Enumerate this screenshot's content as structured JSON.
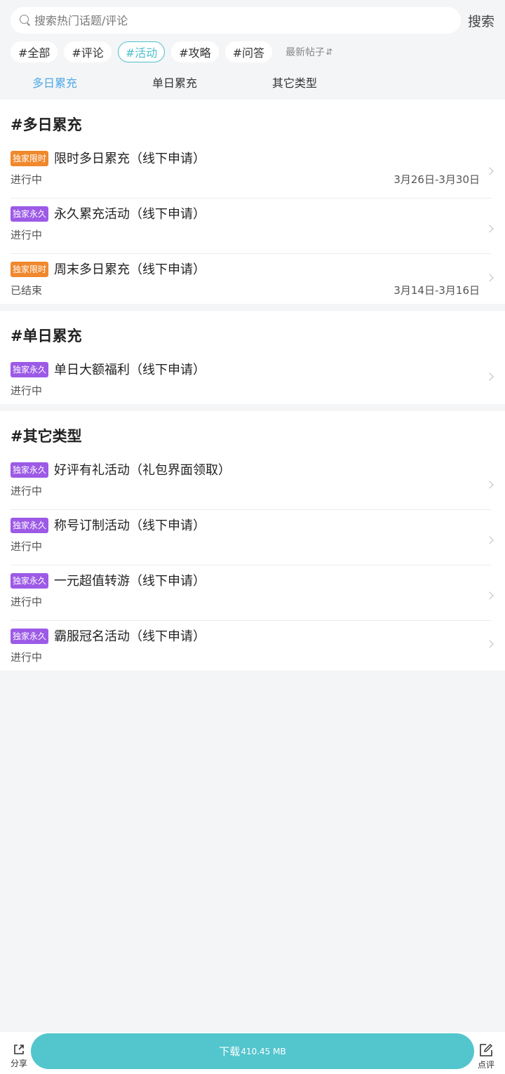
{
  "search": {
    "placeholder": "搜索热门话题/评论",
    "button_label": "搜索"
  },
  "chips": [
    {
      "label": "#全部",
      "active": false
    },
    {
      "label": "#评论",
      "active": false
    },
    {
      "label": "#活动",
      "active": true
    },
    {
      "label": "#攻略",
      "active": false
    },
    {
      "label": "#问答",
      "active": false
    }
  ],
  "sort": {
    "label": "最新帖子",
    "icon": "sort-arrows-icon"
  },
  "subtabs": [
    {
      "label": "多日累充",
      "active": true
    },
    {
      "label": "单日累充",
      "active": false
    },
    {
      "label": "其它类型",
      "active": false
    }
  ],
  "sections": [
    {
      "title": "#多日累充",
      "items": [
        {
          "badge": "独家限时",
          "badge_type": "limit",
          "title": "限时多日累充（线下申请）",
          "status": "进行中",
          "date": "3月26日-3月30日"
        },
        {
          "badge": "独家永久",
          "badge_type": "forever",
          "title": "永久累充活动（线下申请）",
          "status": "进行中",
          "date": ""
        },
        {
          "badge": "独家限时",
          "badge_type": "limit",
          "title": "周末多日累充（线下申请）",
          "status": "已结束",
          "date": "3月14日-3月16日"
        }
      ]
    },
    {
      "title": "#单日累充",
      "items": [
        {
          "badge": "独家永久",
          "badge_type": "forever",
          "title": "单日大额福利（线下申请）",
          "status": "进行中",
          "date": ""
        }
      ]
    },
    {
      "title": "#其它类型",
      "items": [
        {
          "badge": "独家永久",
          "badge_type": "forever",
          "title": "好评有礼活动（礼包界面领取）",
          "status": "进行中",
          "date": ""
        },
        {
          "badge": "独家永久",
          "badge_type": "forever",
          "title": "称号订制活动（线下申请）",
          "status": "进行中",
          "date": ""
        },
        {
          "badge": "独家永久",
          "badge_type": "forever",
          "title": "一元超值转游（线下申请）",
          "status": "进行中",
          "date": ""
        },
        {
          "badge": "独家永久",
          "badge_type": "forever",
          "title": "霸服冠名活动（线下申请）",
          "status": "进行中",
          "date": ""
        }
      ]
    }
  ],
  "bottom_bar": {
    "share_label": "分享",
    "download_label": "下载",
    "download_size": "410.45 MB",
    "comment_label": "点评"
  },
  "colors": {
    "accent": "#53c5cd",
    "active_chip": "#4fc0cc",
    "active_subtab": "#4ea8e6",
    "badge_limit": "#f0882d",
    "badge_forever": "#9c5ae6",
    "background": "#f4f5f7"
  }
}
